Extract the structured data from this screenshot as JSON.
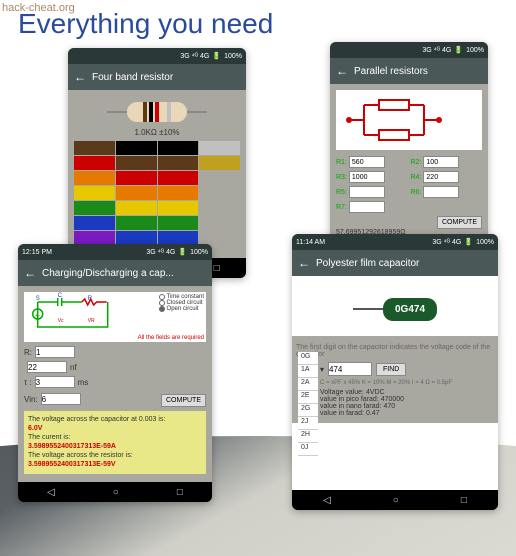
{
  "watermark": "hack-cheat.org",
  "headline": "Everything you need",
  "status": {
    "time1": "",
    "time2": "12:15 PM",
    "time3": "11:14 AM",
    "sig": "3G ⁴ᴳ 4G",
    "bat": "100%"
  },
  "p1": {
    "title": "Four band resistor",
    "value": "1.0KΩ   ±10%",
    "bands": [
      "#5a3a1a",
      "#000",
      "#c00",
      "#999"
    ],
    "colors": [
      "#5a3a1a",
      "#000",
      "#000",
      "#c0c0c0",
      "#c00",
      "#5a3a1a",
      "#5a3a1a",
      "#c0a020",
      "#e67a00",
      "#c00",
      "#c00",
      "",
      "#e6c800",
      "#e67a00",
      "#e67a00",
      "",
      "#1a8a1a",
      "#e6c800",
      "#e6c800",
      "",
      "#1a3ac0",
      "#1a8a1a",
      "#1a8a1a",
      "",
      "#7a1ac0",
      "#1a3ac0",
      "#1a3ac0",
      "",
      "#888",
      "#7a1ac0",
      "#7a1ac0",
      "",
      "#fff",
      "#888",
      "#888",
      ""
    ]
  },
  "p2": {
    "title": "Parallel resistors",
    "r": {
      "r1": "560",
      "r2": "100",
      "r3": "1000",
      "r4": "220",
      "r5": "",
      "r6": "",
      "r7": ""
    },
    "compute": "COMPUTE",
    "result": "57.69951292618959Ω"
  },
  "p3": {
    "title": "Charging/Discharging a cap...",
    "opts": [
      "Time constant",
      "Closed circuit",
      "Open circuit"
    ],
    "warn": "All the fields are required",
    "R": {
      "label": "R:",
      "val": "1",
      "unit": ""
    },
    "C": {
      "label": "",
      "val": "22",
      "unit": "nf"
    },
    "t": {
      "label": "τ :",
      "val": "3",
      "unit": "ms"
    },
    "V": {
      "label": "Vin:",
      "val": "6",
      "unit": ""
    },
    "compute": "COMPUTE",
    "res": {
      "l1": "The voltage across the capacitor at 0.003 is:",
      "v1": "6.0V",
      "l2": "The curent is:",
      "v2": "3.5989552400317313E-59A",
      "l3": "The voltage across the resistor is:",
      "v3": "3.5989552400317313E-59V"
    }
  },
  "p4": {
    "title": "Polyester film capacitor",
    "code": "0G474",
    "desc": "The first digit on the capacitor indicates the voltage code of the capacitor",
    "sel": "0G",
    "inp": "474",
    "find": "FIND",
    "formula": "C = xPF x 45% K = 10% M = 20% I = 4 Ω = 0.5pF",
    "v": {
      "l1": "Voltage value:",
      "v1": "4VDC",
      "l2": "value in pico farad:",
      "v2": "470000",
      "l3": "value in nano farad:",
      "v3": "470",
      "l4": "value in farad:",
      "v4": "0.47"
    },
    "tol": [
      "0G",
      "1A",
      "2A",
      "2E",
      "2G",
      "2J",
      "2H",
      "0J"
    ]
  },
  "nav": {
    "back": "◁",
    "home": "○",
    "recent": "□"
  }
}
